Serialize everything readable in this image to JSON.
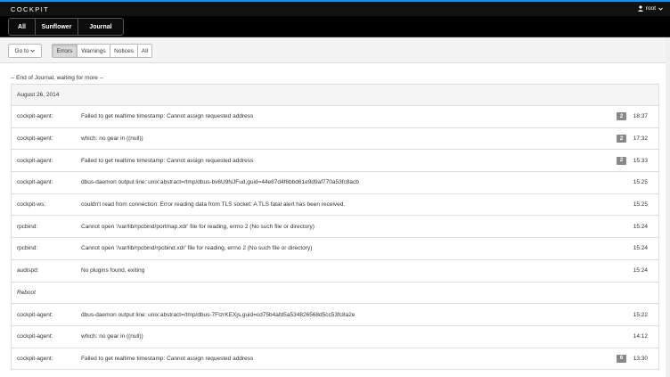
{
  "brand": "COCKPIT",
  "user": {
    "name": "root",
    "icon": "user-icon"
  },
  "nav": {
    "tabs": [
      {
        "label": "All",
        "id": "all"
      },
      {
        "label": "Sunflower",
        "id": "sunflower"
      },
      {
        "label": "Journal",
        "id": "journal"
      }
    ]
  },
  "toolbar": {
    "goto_label": "Go to",
    "priorities": [
      {
        "label": "Errors",
        "id": "errors",
        "active": true
      },
      {
        "label": "Warnings",
        "id": "warnings",
        "active": false
      },
      {
        "label": "Notices",
        "id": "notices",
        "active": false
      },
      {
        "label": "All",
        "id": "all",
        "active": false
      }
    ]
  },
  "journal": {
    "end_text": "-- End of Journal, waiting for more --",
    "day": "August 26, 2014",
    "entries": [
      {
        "ident": "cockpit-agent:",
        "message": "Failed to get realtime timestamp: Cannot assign requested address",
        "count": "2",
        "time": "18:37"
      },
      {
        "ident": "cockpit-agent:",
        "message": "which: no gear in ((null))",
        "count": "2",
        "time": "17:32"
      },
      {
        "ident": "cockpit-agent:",
        "message": "Failed to get realtime timestamp: Cannot assign requested address",
        "count": "2",
        "time": "15:33"
      },
      {
        "ident": "cockpit-agent:",
        "message": "dbus-daemon output line: unix:abstract=/tmp/dbus-bv6U9NJFud,guid=44e87d4f6bbd61e9d9af770a53fc8acb",
        "count": "",
        "time": "15:25"
      },
      {
        "ident": "cockpit-ws:",
        "message": "couldn't read from connection: Error reading data from TLS socket: A TLS fatal alert has been received.",
        "count": "",
        "time": "15:25"
      },
      {
        "ident": "rpcbind:",
        "message": "Cannot open '/var/lib/rpcbind/portmap.xdr' file for reading, errno 2 (No such file or directory)",
        "count": "",
        "time": "15:24"
      },
      {
        "ident": "rpcbind:",
        "message": "Cannot open '/var/lib/rpcbind/rpcbind.xdr' file for reading, errno 2 (No such file or directory)",
        "count": "",
        "time": "15:24"
      },
      {
        "ident": "audispd:",
        "message": "No plugins found, exiting",
        "count": "",
        "time": "15:24"
      }
    ],
    "reboot_label": "Reboot",
    "entries_after_reboot": [
      {
        "ident": "cockpit-agent:",
        "message": "dbus-daemon output line: unix:abstract=/tmp/dbus-7FIzrKEXjs,guid=cd75b4afd5a534826568d5cc53fc8a2e",
        "count": "",
        "time": "15:22"
      },
      {
        "ident": "cockpit-agent:",
        "message": "which: no gear in ((null))",
        "count": "",
        "time": "14:12"
      },
      {
        "ident": "cockpit-agent:",
        "message": "Failed to get realtime timestamp: Cannot assign requested address",
        "count": "6",
        "time": "13:30"
      }
    ]
  },
  "colors": {
    "accent": "#1b8fe0",
    "topbar_bg": "#111111",
    "navbar_bg": "#000000",
    "badge_bg": "#888888",
    "day_bg": "#f5f5f5"
  }
}
